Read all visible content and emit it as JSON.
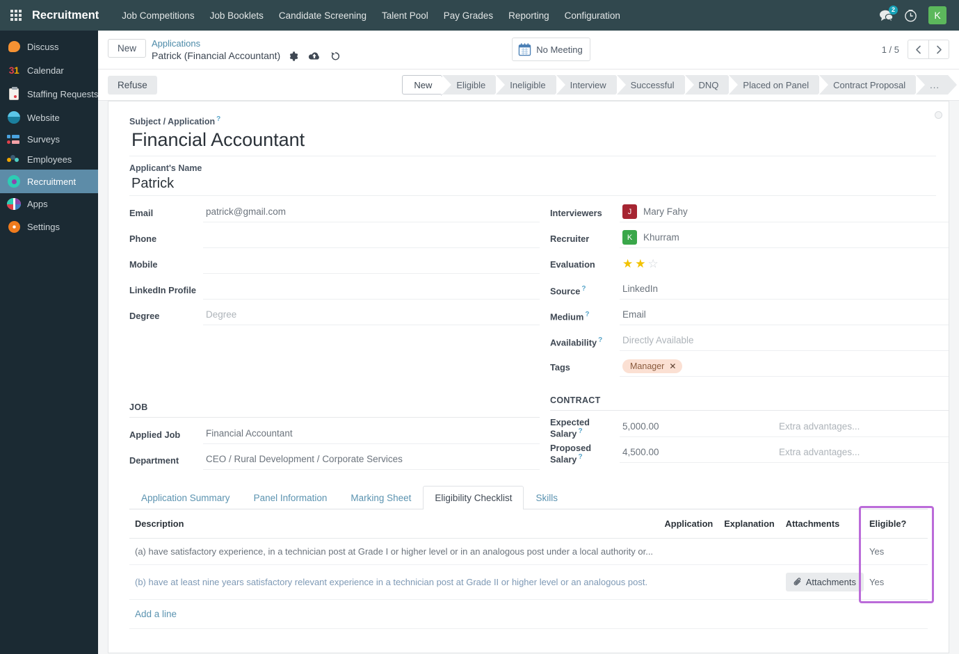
{
  "navbar": {
    "apps_icon": "grid-apps-icon",
    "brand": "Recruitment",
    "menu": [
      "Job Competitions",
      "Job Booklets",
      "Candidate Screening",
      "Talent Pool",
      "Pay Grades",
      "Reporting",
      "Configuration"
    ],
    "messages_icon": "chat-bubble-icon",
    "messages_badge": "2",
    "activities_icon": "clock-icon",
    "avatar_initial": "K",
    "avatar_color": "#5cb85c"
  },
  "sidebar": {
    "items": [
      {
        "label": "Discuss",
        "icon": "discuss-icon",
        "active": false
      },
      {
        "label": "Calendar",
        "icon": "calendar-icon",
        "active": false
      },
      {
        "label": "Staffing Requests",
        "icon": "staffing-requests-icon",
        "active": false
      },
      {
        "label": "Website",
        "icon": "website-icon",
        "active": false
      },
      {
        "label": "Surveys",
        "icon": "surveys-icon",
        "active": false
      },
      {
        "label": "Employees",
        "icon": "employees-icon",
        "active": false
      },
      {
        "label": "Recruitment",
        "icon": "recruitment-icon",
        "active": true
      },
      {
        "label": "Apps",
        "icon": "apps-icon",
        "active": false
      },
      {
        "label": "Settings",
        "icon": "settings-icon",
        "active": false
      }
    ]
  },
  "control_panel": {
    "new_button": "New",
    "breadcrumb_parent": "Applications",
    "breadcrumb_current": "Patrick (Financial Accountant)",
    "gear_icon": "gear-icon",
    "save_icon": "cloud-upload-icon",
    "discard_icon": "discard-undo-icon",
    "meeting_button": "No Meeting",
    "meeting_icon": "calendar-icon",
    "pager_count": "1 / 5",
    "pager_prev_icon": "chevron-left-icon",
    "pager_next_icon": "chevron-right-icon"
  },
  "statusbar": {
    "refuse_button": "Refuse",
    "stages": [
      {
        "label": "New",
        "active": true
      },
      {
        "label": "Eligible",
        "active": false
      },
      {
        "label": "Ineligible",
        "active": false
      },
      {
        "label": "Interview",
        "active": false
      },
      {
        "label": "Successful",
        "active": false
      },
      {
        "label": "DNQ",
        "active": false
      },
      {
        "label": "Placed on Panel",
        "active": false
      },
      {
        "label": "Contract Proposal",
        "active": false
      },
      {
        "label": "...",
        "active": false
      }
    ]
  },
  "form": {
    "subject_label": "Subject / Application",
    "subject_value": "Financial Accountant",
    "applicant_name_label": "Applicant's Name",
    "applicant_name_value": "Patrick",
    "left_fields": [
      {
        "label": "Email",
        "value": "patrick@gmail.com",
        "placeholder": ""
      },
      {
        "label": "Phone",
        "value": "",
        "placeholder": ""
      },
      {
        "label": "Mobile",
        "value": "",
        "placeholder": ""
      },
      {
        "label": "LinkedIn Profile",
        "value": "",
        "placeholder": ""
      },
      {
        "label": "Degree",
        "value": "",
        "placeholder": "Degree"
      }
    ],
    "interviewers_label": "Interviewers",
    "interviewers_value": "Mary Fahy",
    "interviewers_avatar": "J",
    "interviewers_avatar_color": "#a62532",
    "recruiter_label": "Recruiter",
    "recruiter_value": "Khurram",
    "recruiter_avatar": "K",
    "recruiter_avatar_color": "#3aa74a",
    "evaluation_label": "Evaluation",
    "evaluation_filled": 2,
    "evaluation_total": 3,
    "source_label": "Source",
    "source_value": "LinkedIn",
    "medium_label": "Medium",
    "medium_value": "Email",
    "availability_label": "Availability",
    "availability_placeholder": "Directly Available",
    "tags_label": "Tags",
    "tag_value": "Manager",
    "job_section": "JOB",
    "applied_job_label": "Applied Job",
    "applied_job_value": "Financial Accountant",
    "department_label": "Department",
    "department_value": "CEO / Rural Development / Corporate Services",
    "contract_section": "CONTRACT",
    "expected_salary_label": "Expected Salary",
    "expected_salary_value": "5,000.00",
    "expected_salary_extra": "Extra advantages...",
    "proposed_salary_label": "Proposed Salary",
    "proposed_salary_value": "4,500.00",
    "proposed_salary_extra": "Extra advantages..."
  },
  "notebook": {
    "tabs": [
      {
        "label": "Application Summary",
        "active": false
      },
      {
        "label": "Panel Information",
        "active": false
      },
      {
        "label": "Marking Sheet",
        "active": false
      },
      {
        "label": "Eligibility Checklist",
        "active": true
      },
      {
        "label": "Skills",
        "active": false
      }
    ],
    "table": {
      "columns": [
        "Description",
        "Application",
        "Explanation",
        "Attachments",
        "Eligible?"
      ],
      "rows": [
        {
          "description": "(a) have satisfactory experience, in a technician post at Grade I or higher level or in an analogous post under a local authority or...",
          "application": "",
          "explanation": "",
          "attachments": "",
          "eligible": "Yes"
        },
        {
          "description": "(b) have at least nine years satisfactory relevant experience in a technician post at Grade II or higher level or an analogous post.",
          "application": "",
          "explanation": "",
          "attachments": "Attachments",
          "eligible": "Yes"
        }
      ],
      "add_line": "Add a line",
      "attachment_icon": "paperclip-icon"
    }
  },
  "annotation": {
    "highlight_color": "#bb6bd9",
    "highlight_target": "eligible-column"
  }
}
